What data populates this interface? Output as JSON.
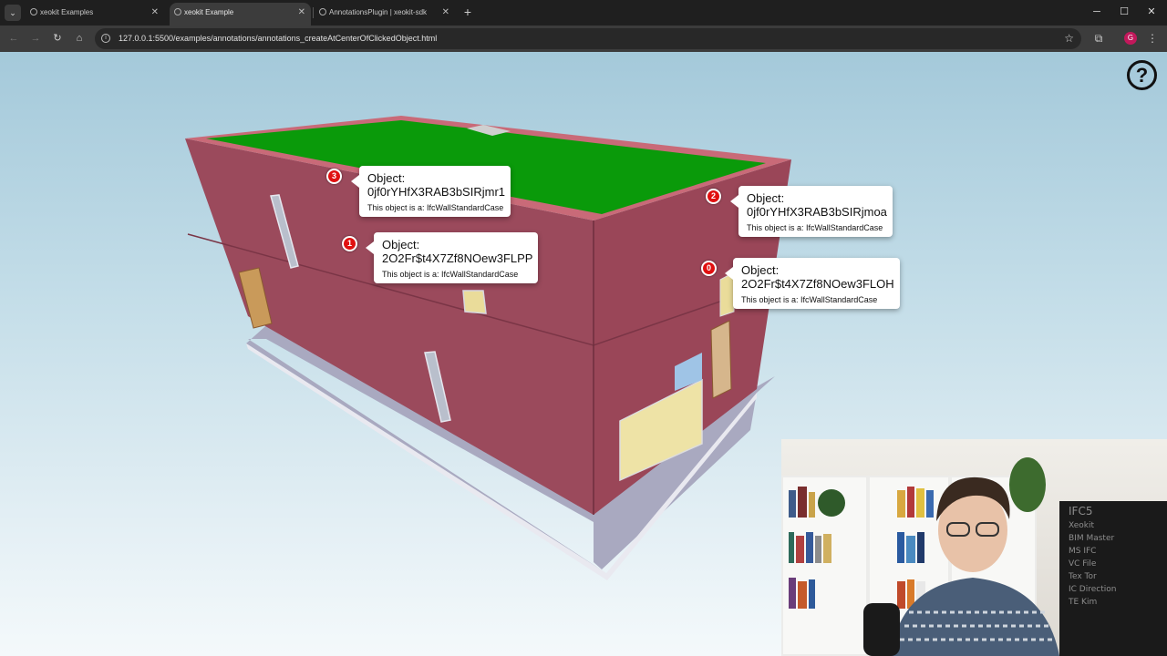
{
  "browser": {
    "tabs": [
      {
        "title": "xeokit Examples",
        "active": false
      },
      {
        "title": "xeokit Example",
        "active": true
      },
      {
        "title": "AnnotationsPlugin | xeokit-sdk",
        "active": false
      }
    ],
    "url": "127.0.0.1:5500/examples/annotations/annotations_createAtCenterOfClickedObject.html",
    "profile_initial": "G",
    "profile_color": "#c2185b"
  },
  "viewer": {
    "help_label": "?",
    "annotations": [
      {
        "marker": "3",
        "title": "Object:",
        "id": "0jf0rYHfX3RAB3bSIRjmr1",
        "desc": "This object is a: IfcWallStandardCase"
      },
      {
        "marker": "2",
        "title": "Object:",
        "id": "0jf0rYHfX3RAB3bSIRjmoa",
        "desc": "This object is a: IfcWallStandardCase"
      },
      {
        "marker": "1",
        "title": "Object:",
        "id": "2O2Fr$t4X7Zf8NOew3FLPP",
        "desc": "This object is a: IfcWallStandardCase"
      },
      {
        "marker": "0",
        "title": "Object:",
        "id": "2O2Fr$t4X7Zf8NOew3FLOH",
        "desc": "This object is a: IfcWallStandardCase"
      }
    ],
    "colors": {
      "wall": "#9b4a5c",
      "roof": "#0a9a0a",
      "base": "#a9a9c0",
      "marker": "#e01010"
    }
  },
  "webcam": {
    "blackboard_lines": [
      "IFC5",
      "Xeokit",
      "BIM Master",
      "MS IFC",
      "VC File",
      "Tex Tor",
      "IC Direction",
      "TE Kim"
    ]
  }
}
